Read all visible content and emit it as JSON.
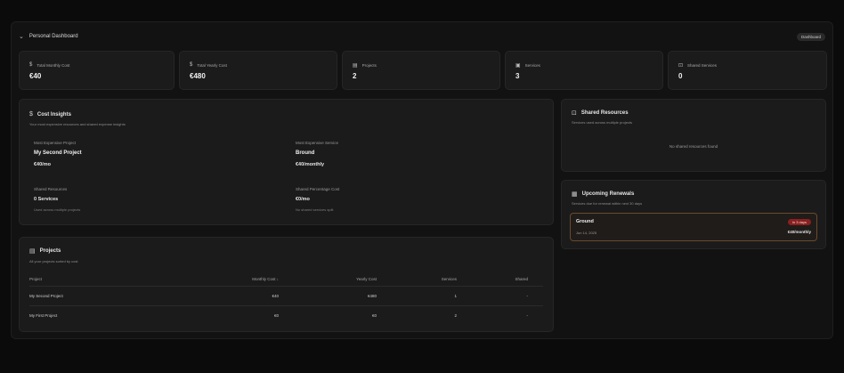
{
  "header": {
    "title": "Personal Dashboard",
    "badge": "Dashboard"
  },
  "stats": [
    {
      "icon": "dollar-icon",
      "label": "Total Monthly Cost",
      "value": "€40"
    },
    {
      "icon": "dollar-icon",
      "label": "Total Yearly Cost",
      "value": "€480"
    },
    {
      "icon": "folder-icon",
      "label": "Projects",
      "value": "2"
    },
    {
      "icon": "server-icon",
      "label": "Services",
      "value": "3"
    },
    {
      "icon": "share-icon",
      "label": "Shared Services",
      "value": "0"
    }
  ],
  "cost_insights": {
    "title": "Cost Insights",
    "subtitle": "Your most expensive resources and shared expense insights",
    "most_expensive_project": {
      "label": "Most Expensive Project",
      "name": "My Second Project",
      "value": "€40/mo"
    },
    "most_expensive_service": {
      "label": "Most Expensive Service",
      "name": "Bround",
      "value": "€40/monthly"
    },
    "shared_resources": {
      "label": "Shared Resources",
      "value": "0 Services",
      "hint": "Used across multiple projects"
    },
    "shared_percentage": {
      "label": "Shared Percentage Cost",
      "value": "€0/mo",
      "hint": "No shared services split"
    }
  },
  "projects": {
    "title": "Projects",
    "subtitle": "All your projects sorted by cost",
    "columns": [
      "Project",
      "Monthly Cost ↓",
      "Yearly Cost",
      "Services",
      "Shared"
    ],
    "rows": [
      {
        "project": "My Second Project",
        "monthly": "€40",
        "yearly": "€480",
        "services": "1",
        "shared": "-"
      },
      {
        "project": "My First Project",
        "monthly": "€0",
        "yearly": "€0",
        "services": "2",
        "shared": "-"
      }
    ]
  },
  "shared": {
    "title": "Shared Resources",
    "subtitle": "Services used across multiple projects",
    "empty": "No shared resources found"
  },
  "renewals": {
    "title": "Upcoming Renewals",
    "subtitle": "Services due for renewal within next 30 days",
    "item": {
      "name": "Ground",
      "date": "Jun 14, 2025",
      "pill": "in 3 days",
      "amount": "€40/monthly"
    }
  }
}
